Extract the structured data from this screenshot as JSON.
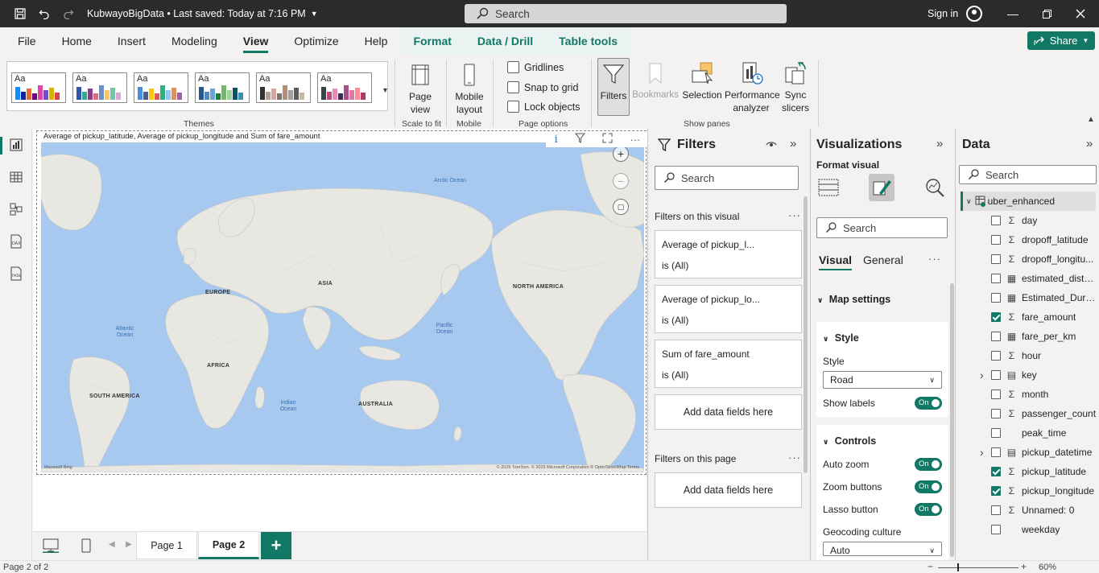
{
  "titlebar": {
    "title": "KubwayoBigData",
    "saved": "Last saved: Today at 7:16 PM",
    "search": "Search",
    "signin": "Sign in"
  },
  "menu": {
    "items": [
      "File",
      "Home",
      "Insert",
      "Modeling",
      "View",
      "Optimize",
      "Help"
    ],
    "context_items": [
      "Format",
      "Data / Drill",
      "Table tools"
    ],
    "share": "Share"
  },
  "ribbon": {
    "themes_label": "Themes",
    "theme_glyph": "Aa",
    "page_view": "Page view",
    "scale_to_fit": "Scale to fit",
    "mobile_layout": "Mobile layout",
    "mobile_group": "Mobile",
    "gridlines": "Gridlines",
    "snap_to_grid": "Snap to grid",
    "lock_objects": "Lock objects",
    "page_options": "Page options",
    "filters": "Filters",
    "bookmarks": "Bookmarks",
    "selection": "Selection",
    "performance_analyzer": "Performance analyzer",
    "sync_slicers": "Sync slicers",
    "show_panes": "Show panes",
    "theme_colors": [
      [
        "#118dff",
        "#12239e",
        "#e66c37",
        "#6b007b",
        "#e044a7",
        "#744ec2",
        "#d9b300",
        "#d64550"
      ],
      [
        "#3257a8",
        "#37a794",
        "#8b3d88",
        "#dd6b7f",
        "#6b91c9",
        "#f5c869",
        "#77c4a8",
        "#dea6cf"
      ],
      [
        "#4a8ddc",
        "#4c5d8a",
        "#f3c911",
        "#dc5b57",
        "#33ae81",
        "#95c8f0",
        "#dd915f",
        "#9a64a0"
      ],
      [
        "#2a5783",
        "#4d8ac0",
        "#69a3d6",
        "#1d7e3b",
        "#76b56e",
        "#a2d39c",
        "#0c4f6b",
        "#3c8bb1"
      ],
      [
        "#333333",
        "#b2a198",
        "#d4a89b",
        "#7b756c",
        "#b08f7b",
        "#a0a0a0",
        "#5b5b5b",
        "#c4b7a5"
      ],
      [
        "#374649",
        "#c04b7a",
        "#e88bb1",
        "#41295a",
        "#a54d8a",
        "#dc7aa2",
        "#ff8c96",
        "#b3376a"
      ]
    ]
  },
  "canvas": {
    "visual_title": "Average of pickup_latitude, Average of pickup_longitude and Sum of fare_amount",
    "labels": {
      "europe": "EUROPE",
      "asia": "ASIA",
      "north_america": "NORTH AMERICA",
      "africa": "AFRICA",
      "south_america": "SOUTH AMERICA",
      "australia": "AUSTRALIA"
    },
    "oceans": {
      "arctic": "Arctic Ocean",
      "atlantic": "Atlantic Ocean",
      "pacific": "Pacific Ocean",
      "indian": "Indian Ocean"
    },
    "copyright": "© 2025 TomTom, © 2025 Microsoft Corporation  © OpenStreetMap  Terms",
    "logo": "Microsoft Bing"
  },
  "pages": {
    "tabs": [
      "Page 1",
      "Page 2"
    ],
    "active": "Page 2"
  },
  "status": {
    "page": "Page 2 of 2",
    "zoom": "60%",
    "zoom_level": 0.3
  },
  "filters": {
    "title": "Filters",
    "search": "Search",
    "on_visual": "Filters on this visual",
    "cards": [
      {
        "name": "Average of pickup_l...",
        "value": "is (All)"
      },
      {
        "name": "Average of pickup_lo...",
        "value": "is (All)"
      },
      {
        "name": "Sum of fare_amount",
        "value": "is (All)"
      }
    ],
    "add_fields": "Add data fields here",
    "on_page": "Filters on this page"
  },
  "visualizations": {
    "title": "Visualizations",
    "format_visual": "Format visual",
    "search": "Search",
    "tabs": [
      "Visual",
      "General"
    ],
    "map_settings": "Map settings",
    "style": {
      "header": "Style",
      "label": "Style",
      "value": "Road",
      "show_labels": "Show labels",
      "show_labels_state": "On"
    },
    "controls": {
      "header": "Controls",
      "auto_zoom": "Auto zoom",
      "zoom_buttons": "Zoom buttons",
      "lasso_button": "Lasso button",
      "state": "On",
      "geocoding": "Geocoding culture",
      "geocoding_value": "Auto"
    }
  },
  "data": {
    "title": "Data",
    "search": "Search",
    "table": "uber_enhanced",
    "fields": [
      {
        "name": "day",
        "type": "sigma",
        "checked": false
      },
      {
        "name": "dropoff_latitude",
        "type": "sigma",
        "checked": false
      },
      {
        "name": "dropoff_longitu...",
        "type": "sigma",
        "checked": false
      },
      {
        "name": "estimated_dista...",
        "type": "calc",
        "checked": false
      },
      {
        "name": "Estimated_Dura...",
        "type": "calc",
        "checked": false
      },
      {
        "name": "fare_amount",
        "type": "sigma",
        "checked": true
      },
      {
        "name": "fare_per_km",
        "type": "calc",
        "checked": false
      },
      {
        "name": "hour",
        "type": "sigma",
        "checked": false
      },
      {
        "name": "key",
        "type": "calendar",
        "checked": false,
        "expand": true
      },
      {
        "name": "month",
        "type": "sigma",
        "checked": false
      },
      {
        "name": "passenger_count",
        "type": "sigma",
        "checked": false
      },
      {
        "name": "peak_time",
        "type": "none",
        "checked": false
      },
      {
        "name": "pickup_datetime",
        "type": "calendar",
        "checked": false,
        "expand": true
      },
      {
        "name": "pickup_latitude",
        "type": "sigma",
        "checked": true
      },
      {
        "name": "pickup_longitude",
        "type": "sigma",
        "checked": true
      },
      {
        "name": "Unnamed: 0",
        "type": "sigma",
        "checked": false
      },
      {
        "name": "weekday",
        "type": "none",
        "checked": false
      }
    ]
  }
}
